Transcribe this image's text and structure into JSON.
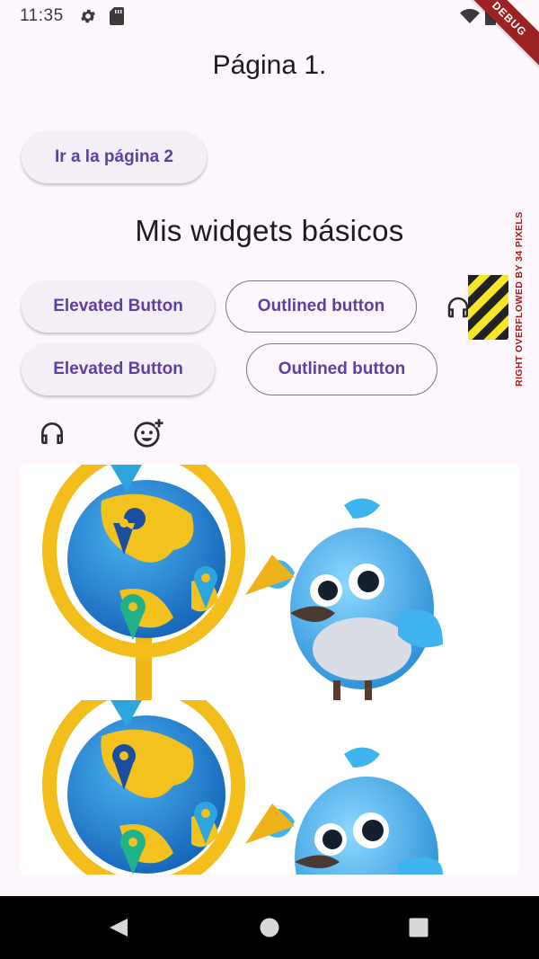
{
  "status_bar": {
    "time": "11:35",
    "icons": [
      "gear-icon",
      "sd-card-icon",
      "wifi-icon",
      "battery-icon"
    ],
    "debug_label": "DEBUG"
  },
  "page": {
    "title": "Página 1."
  },
  "nav_button": {
    "label": "Ir a la página 2"
  },
  "section": {
    "title": "Mis widgets básicos"
  },
  "buttons_row1": {
    "elevated_label": "Elevated Button",
    "outlined_label": "Outlined button",
    "icon": "headphones-icon"
  },
  "buttons_row2": {
    "elevated_label": "Elevated Button",
    "outlined_label": "Outlined button"
  },
  "overflow_warning": "RIGHT OVERFLOWED BY 34 PIXELS",
  "icons_row": [
    "headphones-icon",
    "add-reaction-icon"
  ],
  "images": [
    {
      "description": "globe-and-bird-illustration"
    },
    {
      "description": "globe-and-bird-illustration"
    }
  ],
  "system_nav": [
    "back-icon",
    "home-icon",
    "recents-icon"
  ],
  "colors": {
    "background": "#fdf7fd",
    "accent": "#5e3fa0",
    "debug_banner": "#9b2222"
  }
}
